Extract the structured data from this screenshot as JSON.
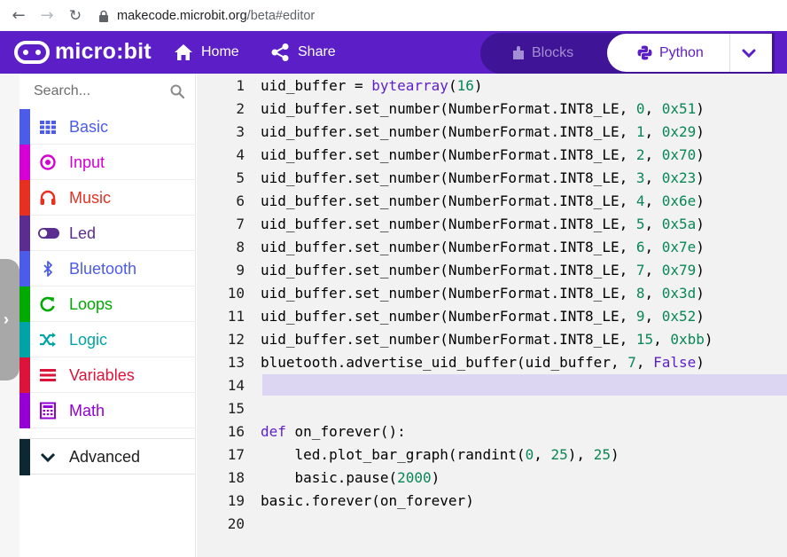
{
  "browser": {
    "url_host": "makecode.microbit.org",
    "url_path": "/beta#editor"
  },
  "header": {
    "logo_text": "micro:bit",
    "home_label": "Home",
    "share_label": "Share",
    "blocks_label": "Blocks",
    "python_label": "Python",
    "colors": {
      "bar": "#5c1fc7",
      "toggle": "#3f1496"
    }
  },
  "sidebar": {
    "search_placeholder": "Search...",
    "categories": [
      {
        "label": "Basic",
        "color": "#4c5be8",
        "icon": "grid-icon"
      },
      {
        "label": "Input",
        "color": "#d400d4",
        "icon": "target-icon"
      },
      {
        "label": "Music",
        "color": "#e63022",
        "icon": "headphones-icon"
      },
      {
        "label": "Led",
        "color": "#5c2d91",
        "icon": "toggle-icon"
      },
      {
        "label": "Bluetooth",
        "color": "#4c5be8",
        "icon": "bluetooth-icon"
      },
      {
        "label": "Loops",
        "color": "#00aa00",
        "icon": "loop-icon"
      },
      {
        "label": "Logic",
        "color": "#00a4a6",
        "icon": "shuffle-icon"
      },
      {
        "label": "Variables",
        "color": "#dc143c",
        "icon": "list-icon"
      },
      {
        "label": "Math",
        "color": "#9400d3",
        "icon": "calculator-icon"
      }
    ],
    "advanced_label": "Advanced"
  },
  "editor": {
    "lines": [
      {
        "n": "1",
        "tokens": [
          [
            "uid_buffer = ",
            "p"
          ],
          [
            "bytearray",
            "c"
          ],
          [
            "(",
            "p"
          ],
          [
            "16",
            "n"
          ],
          [
            ")",
            "p"
          ]
        ]
      },
      {
        "n": "2",
        "tokens": [
          [
            "uid_buffer.set_number(NumberFormat.INT8_LE, ",
            "p"
          ],
          [
            "0",
            "n"
          ],
          [
            ", ",
            "p"
          ],
          [
            "0x51",
            "n"
          ],
          [
            ")",
            "p"
          ]
        ]
      },
      {
        "n": "3",
        "tokens": [
          [
            "uid_buffer.set_number(NumberFormat.INT8_LE, ",
            "p"
          ],
          [
            "1",
            "n"
          ],
          [
            ", ",
            "p"
          ],
          [
            "0x29",
            "n"
          ],
          [
            ")",
            "p"
          ]
        ]
      },
      {
        "n": "4",
        "tokens": [
          [
            "uid_buffer.set_number(NumberFormat.INT8_LE, ",
            "p"
          ],
          [
            "2",
            "n"
          ],
          [
            ", ",
            "p"
          ],
          [
            "0x70",
            "n"
          ],
          [
            ")",
            "p"
          ]
        ]
      },
      {
        "n": "5",
        "tokens": [
          [
            "uid_buffer.set_number(NumberFormat.INT8_LE, ",
            "p"
          ],
          [
            "3",
            "n"
          ],
          [
            ", ",
            "p"
          ],
          [
            "0x23",
            "n"
          ],
          [
            ")",
            "p"
          ]
        ]
      },
      {
        "n": "6",
        "tokens": [
          [
            "uid_buffer.set_number(NumberFormat.INT8_LE, ",
            "p"
          ],
          [
            "4",
            "n"
          ],
          [
            ", ",
            "p"
          ],
          [
            "0x6e",
            "n"
          ],
          [
            ")",
            "p"
          ]
        ]
      },
      {
        "n": "7",
        "tokens": [
          [
            "uid_buffer.set_number(NumberFormat.INT8_LE, ",
            "p"
          ],
          [
            "5",
            "n"
          ],
          [
            ", ",
            "p"
          ],
          [
            "0x5a",
            "n"
          ],
          [
            ")",
            "p"
          ]
        ]
      },
      {
        "n": "8",
        "tokens": [
          [
            "uid_buffer.set_number(NumberFormat.INT8_LE, ",
            "p"
          ],
          [
            "6",
            "n"
          ],
          [
            ", ",
            "p"
          ],
          [
            "0x7e",
            "n"
          ],
          [
            ")",
            "p"
          ]
        ]
      },
      {
        "n": "9",
        "tokens": [
          [
            "uid_buffer.set_number(NumberFormat.INT8_LE, ",
            "p"
          ],
          [
            "7",
            "n"
          ],
          [
            ", ",
            "p"
          ],
          [
            "0x79",
            "n"
          ],
          [
            ")",
            "p"
          ]
        ]
      },
      {
        "n": "10",
        "tokens": [
          [
            "uid_buffer.set_number(NumberFormat.INT8_LE, ",
            "p"
          ],
          [
            "8",
            "n"
          ],
          [
            ", ",
            "p"
          ],
          [
            "0x3d",
            "n"
          ],
          [
            ")",
            "p"
          ]
        ]
      },
      {
        "n": "11",
        "tokens": [
          [
            "uid_buffer.set_number(NumberFormat.INT8_LE, ",
            "p"
          ],
          [
            "9",
            "n"
          ],
          [
            ", ",
            "p"
          ],
          [
            "0x52",
            "n"
          ],
          [
            ")",
            "p"
          ]
        ]
      },
      {
        "n": "12",
        "tokens": [
          [
            "uid_buffer.set_number(NumberFormat.INT8_LE, ",
            "p"
          ],
          [
            "15",
            "n"
          ],
          [
            ", ",
            "p"
          ],
          [
            "0xbb",
            "n"
          ],
          [
            ")",
            "p"
          ]
        ]
      },
      {
        "n": "13",
        "tokens": [
          [
            "bluetooth.advertise_uid_buffer(uid_buffer, ",
            "p"
          ],
          [
            "7",
            "n"
          ],
          [
            ", ",
            "p"
          ],
          [
            "False",
            "k"
          ],
          [
            ")",
            "p"
          ]
        ]
      },
      {
        "n": "14",
        "tokens": []
      },
      {
        "n": "15",
        "tokens": []
      },
      {
        "n": "16",
        "tokens": [
          [
            "def",
            "k"
          ],
          [
            " on_forever():",
            "p"
          ]
        ]
      },
      {
        "n": "17",
        "tokens": [
          [
            "    led.plot_bar_graph(randint(",
            "p"
          ],
          [
            "0",
            "n"
          ],
          [
            ", ",
            "p"
          ],
          [
            "25",
            "n"
          ],
          [
            "), ",
            "p"
          ],
          [
            "25",
            "n"
          ],
          [
            ")",
            "p"
          ]
        ]
      },
      {
        "n": "18",
        "tokens": [
          [
            "    basic.pause(",
            "p"
          ],
          [
            "2000",
            "n"
          ],
          [
            ")",
            "p"
          ]
        ]
      },
      {
        "n": "19",
        "tokens": [
          [
            "basic.forever(on_forever)",
            "p"
          ]
        ]
      },
      {
        "n": "20",
        "tokens": []
      }
    ]
  }
}
